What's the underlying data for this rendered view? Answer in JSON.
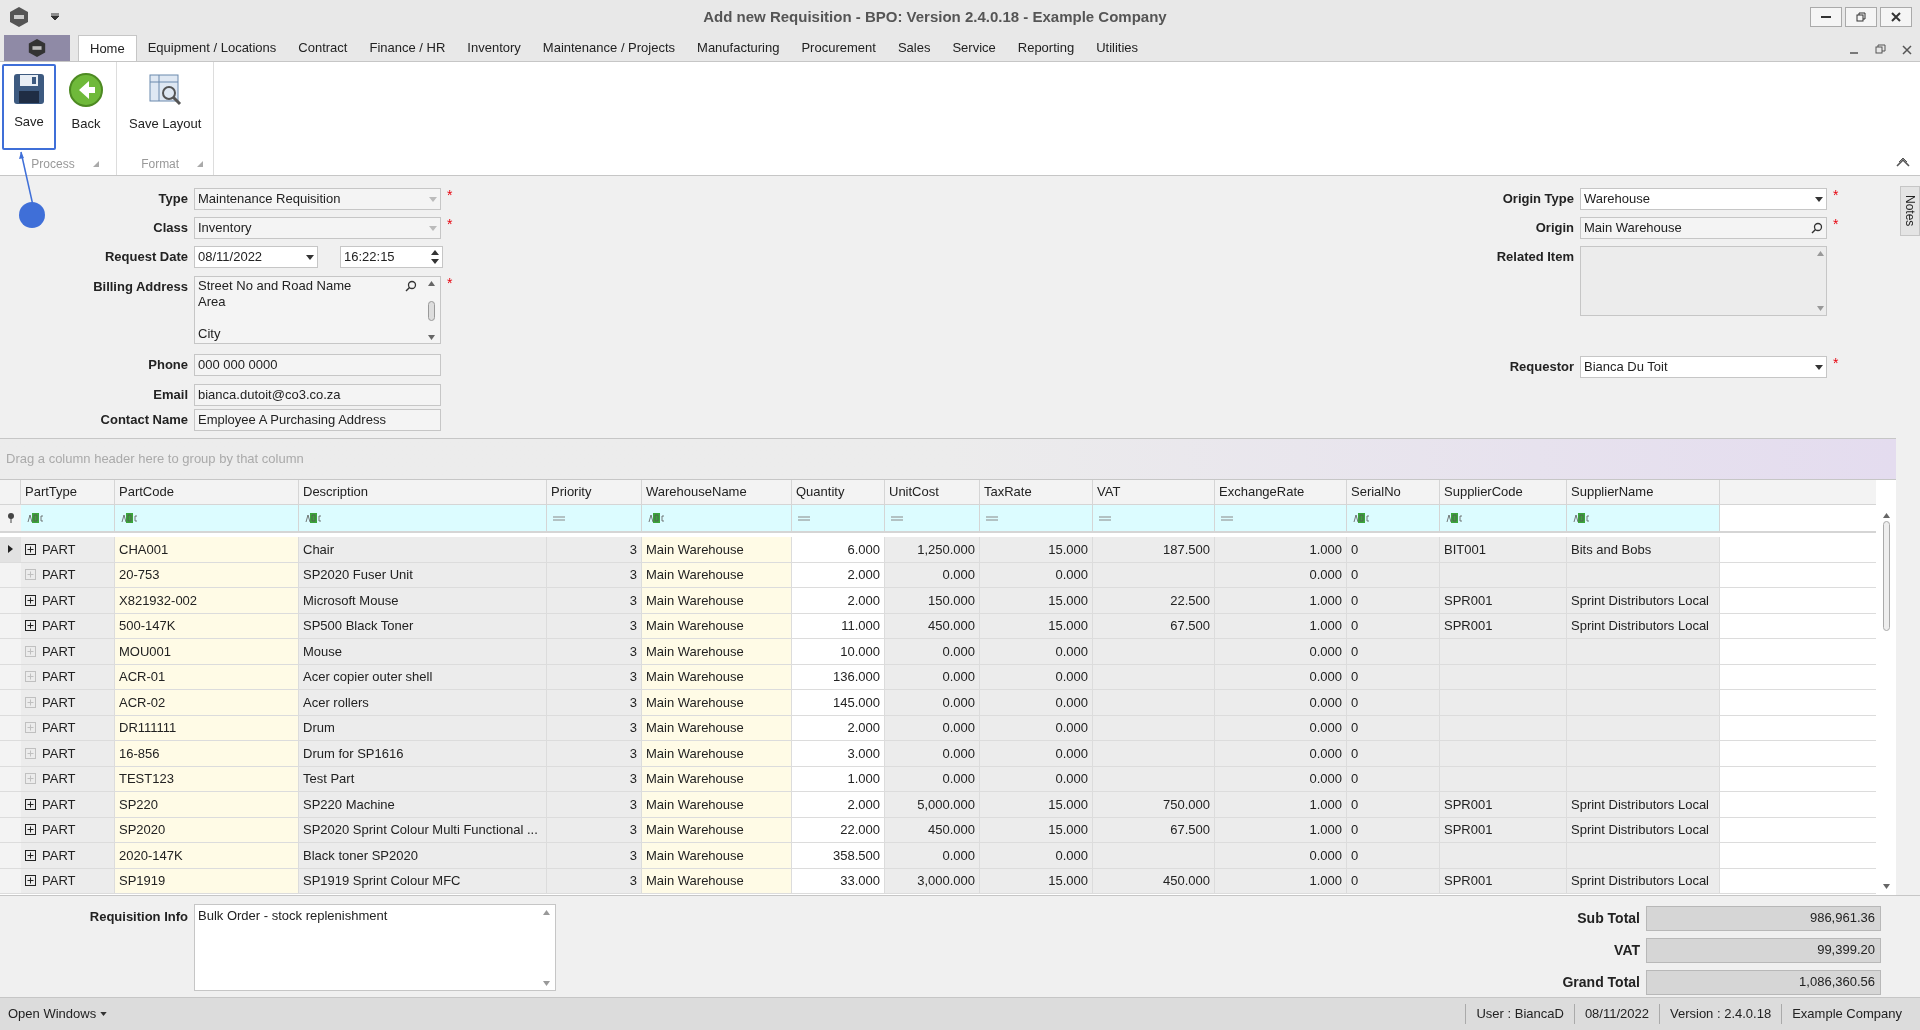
{
  "window": {
    "title": "Add new Requisition - BPO: Version 2.4.0.18 - Example Company"
  },
  "menu_tabs": [
    {
      "label": "Home",
      "selected": true
    },
    {
      "label": "Equipment / Locations",
      "selected": false
    },
    {
      "label": "Contract",
      "selected": false
    },
    {
      "label": "Finance / HR",
      "selected": false
    },
    {
      "label": "Inventory",
      "selected": false
    },
    {
      "label": "Maintenance / Projects",
      "selected": false
    },
    {
      "label": "Manufacturing",
      "selected": false
    },
    {
      "label": "Procurement",
      "selected": false
    },
    {
      "label": "Sales",
      "selected": false
    },
    {
      "label": "Service",
      "selected": false
    },
    {
      "label": "Reporting",
      "selected": false
    },
    {
      "label": "Utilities",
      "selected": false
    }
  ],
  "ribbon_groups": [
    {
      "label": "Process",
      "buttons": [
        {
          "label": "Save",
          "kind": "save",
          "highlighted": true
        },
        {
          "label": "Back",
          "kind": "back",
          "highlighted": false
        }
      ]
    },
    {
      "label": "Format",
      "buttons": [
        {
          "label": "Save Layout",
          "kind": "layout",
          "highlighted": false
        }
      ]
    }
  ],
  "form_left": [
    {
      "label": "Type",
      "kind": "combo",
      "value": "Maintenance Requisition",
      "required_marker": "*",
      "disabled": true
    },
    {
      "label": "Class",
      "kind": "combo",
      "value": "Inventory",
      "required_marker": "*",
      "disabled": true
    },
    {
      "label": "Request Date",
      "kind": "datetime",
      "value": "08/11/2022",
      "time": "16:22:15"
    },
    {
      "label": "Billing Address",
      "kind": "address",
      "street": "Street No and Road Name",
      "area": "Area",
      "city": "City",
      "required_marker": "*"
    },
    {
      "label": "Phone",
      "kind": "text",
      "value": "000 000 0000"
    },
    {
      "label": "Email",
      "kind": "text",
      "value": "bianca.dutoit@co3.co.za"
    },
    {
      "label": "Contact Name",
      "kind": "text",
      "value": "Employee A Purchasing Address"
    }
  ],
  "form_right": [
    {
      "label": "Origin Type",
      "kind": "combo",
      "value": "Warehouse",
      "required_marker": "*",
      "disabled": false
    },
    {
      "label": "Origin",
      "kind": "search",
      "value": "Main Warehouse",
      "required_marker": "*"
    },
    {
      "label": "Related Item",
      "kind": "memo"
    },
    {
      "label": "Requestor",
      "kind": "combo",
      "value": "Bianca Du Toit",
      "required_marker": "*",
      "disabled": false
    }
  ],
  "notes_tab": "Notes",
  "group_panel_hint": "Drag a column header here to group by that column",
  "grid": {
    "columns": [
      {
        "label": "PartType",
        "kind": "text",
        "color": "#ececec"
      },
      {
        "label": "PartCode",
        "kind": "text",
        "color": "#fffbe6"
      },
      {
        "label": "Description",
        "kind": "text",
        "color": "#ececec"
      },
      {
        "label": "Priority",
        "kind": "number",
        "color": "#ececec"
      },
      {
        "label": "WarehouseName",
        "kind": "text",
        "color": "#fffbe6"
      },
      {
        "label": "Quantity",
        "kind": "number",
        "color": "#ffffff"
      },
      {
        "label": "UnitCost",
        "kind": "number",
        "color": "#ececec"
      },
      {
        "label": "TaxRate",
        "kind": "number",
        "color": "#ececec"
      },
      {
        "label": "VAT",
        "kind": "number",
        "color": "#ececec"
      },
      {
        "label": "ExchangeRate",
        "kind": "number",
        "color": "#ececec"
      },
      {
        "label": "SerialNo",
        "kind": "text",
        "color": "#ececec"
      },
      {
        "label": "SupplierCode",
        "kind": "text",
        "color": "#ececec"
      },
      {
        "label": "SupplierName",
        "kind": "text",
        "color": "#ececec"
      }
    ],
    "rows": [
      {
        "selected": true,
        "expandable": true,
        "cells": [
          "PART",
          "CHA001",
          "Chair",
          "3",
          "Main Warehouse",
          "6.000",
          "1,250.000",
          "15.000",
          "187.500",
          "1.000",
          "0",
          "BIT001",
          "Bits and Bobs"
        ]
      },
      {
        "selected": false,
        "expandable": false,
        "cells": [
          "PART",
          "20-753",
          "SP2020 Fuser Unit",
          "3",
          "Main Warehouse",
          "2.000",
          "0.000",
          "0.000",
          null,
          "0.000",
          "0",
          null,
          null
        ]
      },
      {
        "selected": false,
        "expandable": true,
        "cells": [
          "PART",
          "X821932-002",
          "Microsoft Mouse",
          "3",
          "Main Warehouse",
          "2.000",
          "150.000",
          "15.000",
          "22.500",
          "1.000",
          "0",
          "SPR001",
          "Sprint Distributors Local"
        ]
      },
      {
        "selected": false,
        "expandable": true,
        "cells": [
          "PART",
          "500-147K",
          "SP500 Black Toner",
          "3",
          "Main Warehouse",
          "11.000",
          "450.000",
          "15.000",
          "67.500",
          "1.000",
          "0",
          "SPR001",
          "Sprint Distributors Local"
        ]
      },
      {
        "selected": false,
        "expandable": false,
        "cells": [
          "PART",
          "MOU001",
          "Mouse",
          "3",
          "Main Warehouse",
          "10.000",
          "0.000",
          "0.000",
          null,
          "0.000",
          "0",
          null,
          null
        ]
      },
      {
        "selected": false,
        "expandable": false,
        "cells": [
          "PART",
          "ACR-01",
          "Acer copier outer shell",
          "3",
          "Main Warehouse",
          "136.000",
          "0.000",
          "0.000",
          null,
          "0.000",
          "0",
          null,
          null
        ]
      },
      {
        "selected": false,
        "expandable": false,
        "cells": [
          "PART",
          "ACR-02",
          "Acer rollers",
          "3",
          "Main Warehouse",
          "145.000",
          "0.000",
          "0.000",
          null,
          "0.000",
          "0",
          null,
          null
        ]
      },
      {
        "selected": false,
        "expandable": false,
        "cells": [
          "PART",
          "DR111111",
          "Drum",
          "3",
          "Main Warehouse",
          "2.000",
          "0.000",
          "0.000",
          null,
          "0.000",
          "0",
          null,
          null
        ]
      },
      {
        "selected": false,
        "expandable": false,
        "cells": [
          "PART",
          "16-856",
          "Drum for SP1616",
          "3",
          "Main Warehouse",
          "3.000",
          "0.000",
          "0.000",
          null,
          "0.000",
          "0",
          null,
          null
        ]
      },
      {
        "selected": false,
        "expandable": false,
        "cells": [
          "PART",
          "TEST123",
          "Test Part",
          "3",
          "Main Warehouse",
          "1.000",
          "0.000",
          "0.000",
          null,
          "0.000",
          "0",
          null,
          null
        ]
      },
      {
        "selected": false,
        "expandable": true,
        "cells": [
          "PART",
          "SP220",
          "SP220 Machine",
          "3",
          "Main Warehouse",
          "2.000",
          "5,000.000",
          "15.000",
          "750.000",
          "1.000",
          "0",
          "SPR001",
          "Sprint Distributors Local"
        ]
      },
      {
        "selected": false,
        "expandable": true,
        "cells": [
          "PART",
          "SP2020",
          "SP2020 Sprint Colour Multi Functional ...",
          "3",
          "Main Warehouse",
          "22.000",
          "450.000",
          "15.000",
          "67.500",
          "1.000",
          "0",
          "SPR001",
          "Sprint Distributors Local"
        ]
      },
      {
        "selected": false,
        "expandable": true,
        "cells": [
          "PART",
          "2020-147K",
          "Black toner SP2020",
          "3",
          "Main Warehouse",
          "358.500",
          "0.000",
          "0.000",
          null,
          "0.000",
          "0",
          null,
          null
        ]
      },
      {
        "selected": false,
        "expandable": true,
        "cells": [
          "PART",
          "SP1919",
          "SP1919 Sprint Colour MFC",
          "3",
          "Main Warehouse",
          "33.000",
          "3,000.000",
          "15.000",
          "450.000",
          "1.000",
          "0",
          "SPR001",
          "Sprint Distributors Local"
        ]
      }
    ]
  },
  "requisition_info": {
    "label": "Requisition Info",
    "value": "Bulk Order - stock replenishment"
  },
  "totals": [
    {
      "label": "Sub Total",
      "value": "986,961.36"
    },
    {
      "label": "VAT",
      "value": "99,399.20"
    },
    {
      "label": "Grand Total",
      "value": "1,086,360.56"
    }
  ],
  "status_bar": {
    "open_windows": "Open Windows",
    "items": [
      "User : BiancaD",
      "08/11/2022",
      "Version : 2.4.0.18",
      "Example Company"
    ]
  }
}
